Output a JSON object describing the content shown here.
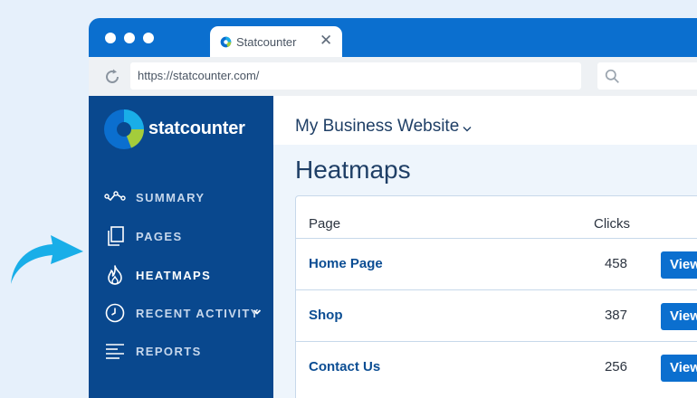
{
  "browser": {
    "tab_title": "Statcounter",
    "url": "https://statcounter.com/"
  },
  "sidebar": {
    "brand": "statcounter",
    "items": [
      {
        "label": "SUMMARY",
        "icon": "summary-graph-icon"
      },
      {
        "label": "PAGES",
        "icon": "pages-icon"
      },
      {
        "label": "HEATMAPS",
        "icon": "flame-icon",
        "active": true
      },
      {
        "label": "RECENT ACTIVITY",
        "icon": "clock-icon",
        "has_dropdown": true
      },
      {
        "label": "REPORTS",
        "icon": "reports-icon"
      }
    ]
  },
  "main": {
    "site_name": "My Business Website",
    "page_title": "Heatmaps",
    "table": {
      "columns": [
        "Page",
        "Clicks"
      ],
      "rows": [
        {
          "page": "Home Page",
          "clicks": "458",
          "action": "View"
        },
        {
          "page": "Shop",
          "clicks": "387",
          "action": "View"
        },
        {
          "page": "Contact Us",
          "clicks": "256",
          "action": "View"
        }
      ]
    }
  },
  "colors": {
    "accent": "#0b6fcf",
    "sidebar": "#09488e",
    "arrow": "#19aee8",
    "logo_green": "#a4cc3b"
  }
}
